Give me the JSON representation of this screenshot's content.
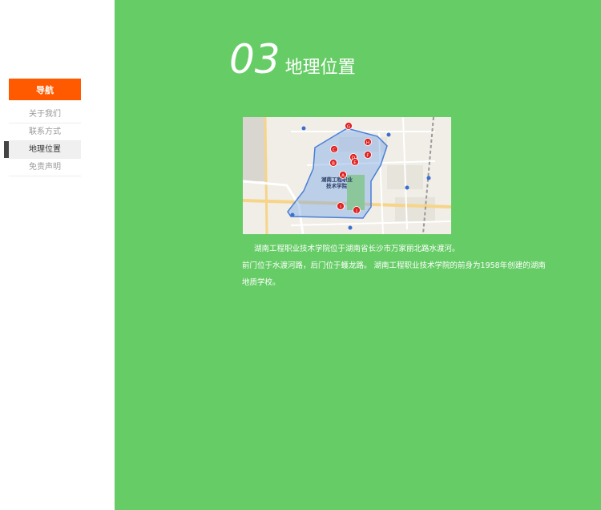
{
  "sidebar": {
    "header_label": "导航",
    "items": [
      {
        "label": "关于我们"
      },
      {
        "label": "联系方式"
      },
      {
        "label": "地理位置"
      },
      {
        "label": "免责声明"
      }
    ]
  },
  "section": {
    "number": "03",
    "title": "地理位置"
  },
  "map": {
    "campus_label_line1": "湖南工程职业",
    "campus_label_line2": "技术学院",
    "marker_letters": [
      "A",
      "B",
      "C",
      "D",
      "E",
      "F",
      "G",
      "H",
      "I",
      "J"
    ]
  },
  "description": {
    "line1": "湖南工程职业技术学院位于湖南省长沙市万家丽北路水渡河。",
    "line2": "前门位于水渡河路，后门位于蠖龙路。 湖南工程职业技术学院的前身为1958年创建的湖南",
    "line3": "地质学校。"
  },
  "colors": {
    "nav_accent": "#ff5a00",
    "main_bg": "#66cc66",
    "map_polygon": "#4a7fd4",
    "marker": "#e02020"
  }
}
